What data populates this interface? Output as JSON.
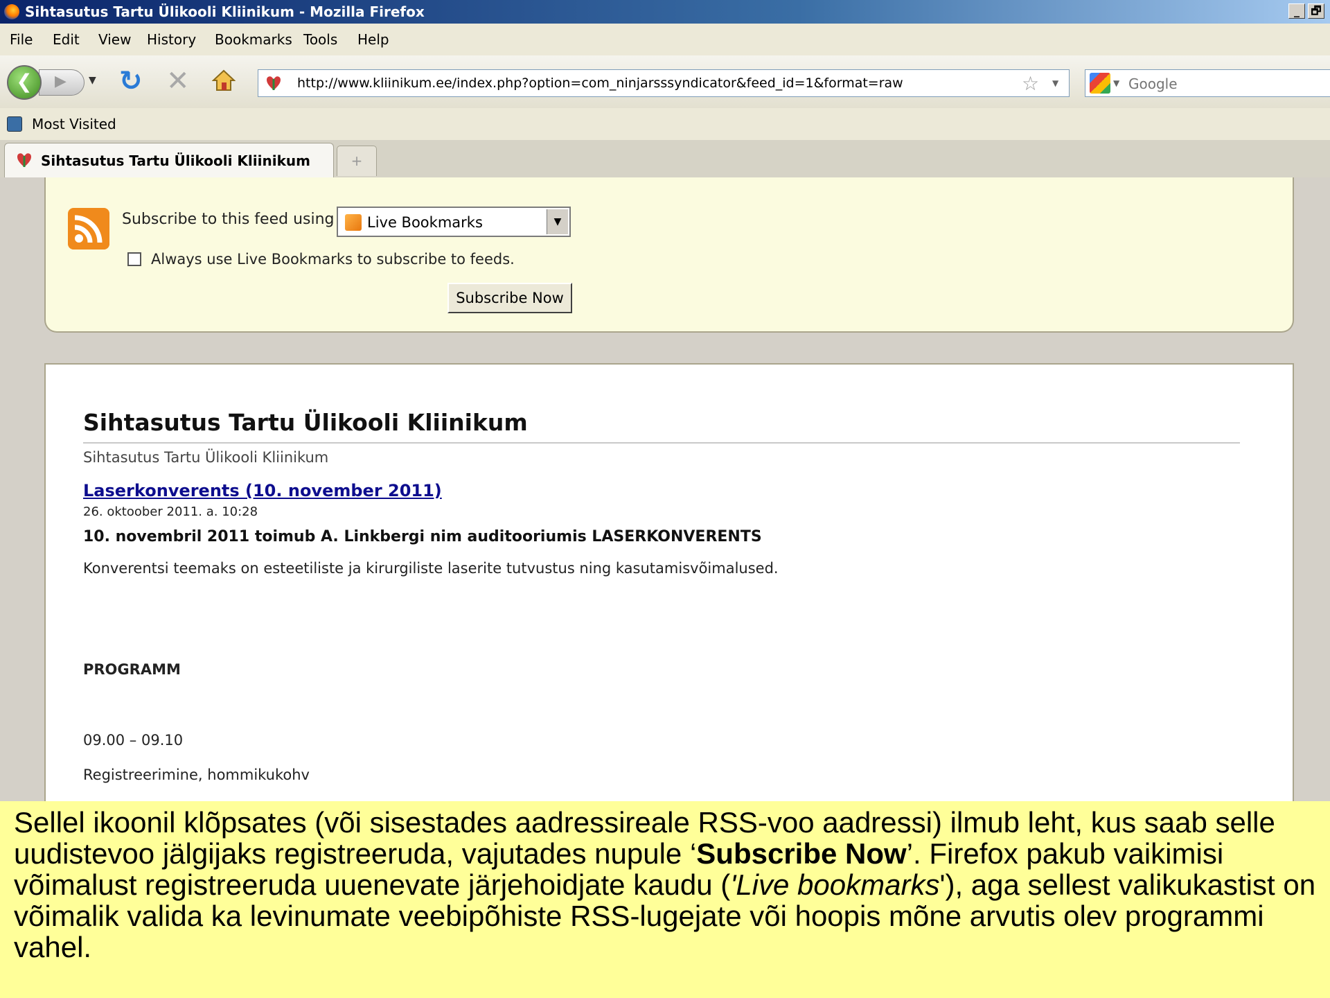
{
  "window": {
    "title": "Sihtasutus Tartu Ülikooli Kliinikum - Mozilla Firefox",
    "buttons": {
      "minimize": "_",
      "restore": "🗗"
    }
  },
  "menu": {
    "items": [
      "File",
      "Edit",
      "View",
      "History",
      "Bookmarks",
      "Tools",
      "Help"
    ]
  },
  "nav": {
    "url": "http://www.kliinikum.ee/index.php?option=com_ninjarsssyndicator&feed_id=1&format=raw",
    "search_placeholder": "Google",
    "icons": [
      "back-arrow-icon",
      "forward-arrow-icon",
      "reload-icon",
      "stop-icon",
      "home-icon",
      "star-icon",
      "google-icon"
    ]
  },
  "bookmarks_bar": {
    "items": [
      "Most Visited"
    ]
  },
  "tabs": {
    "active_label": "Sihtasutus Tartu Ülikooli Kliinikum",
    "new_tab": "+"
  },
  "feed_subscribe": {
    "label": "Subscribe to this feed using",
    "reader_selected": "Live Bookmarks",
    "always_label": "Always use Live Bookmarks to subscribe to feeds.",
    "always_checked": false,
    "button": "Subscribe Now"
  },
  "feed": {
    "title": "Sihtasutus Tartu Ülikooli Kliinikum",
    "subtitle": "Sihtasutus Tartu Ülikooli Kliinikum",
    "entry": {
      "link": "Laserkonverents (10. november 2011)",
      "date": "26. oktoober 2011. a. 10:28",
      "heading": "10. novembril 2011 toimub A. Linkbergi nim auditooriumis LASERKONVERENTS",
      "body": "Konverentsi teemaks on esteetiliste ja kirurgiliste laserite tutvustus ning kasutamisvõimalused.",
      "program": "PROGRAMM",
      "time": "09.00 – 09.10",
      "registration": "Registreerimine, hommikukohv"
    }
  },
  "caption": {
    "part1": "Sellel ikoonil klõpsates (või sisestades aadressireale RSS-voo aadressi) ilmub leht, kus saab selle uudistevoo jälgijaks registreeruda, vajutades nupule ‘",
    "bold": "Subscribe Now",
    "part2": "’. Firefox pakub vaikimisi võimalust registreeruda uuenevate järjehoidjate kaudu (",
    "italic": "'Live bookmarks",
    "part3": "'), aga sellest valikukastist on võimalik valida ka levinumate veebipõhiste RSS-lugejate või hoopis mõne arvutis olev programmi vahel."
  },
  "colors": {
    "caption_bg": "#ffff99",
    "feed_box_bg": "#fbfbdf",
    "arrow": "#ff0000",
    "link": "#0d0d8e"
  }
}
